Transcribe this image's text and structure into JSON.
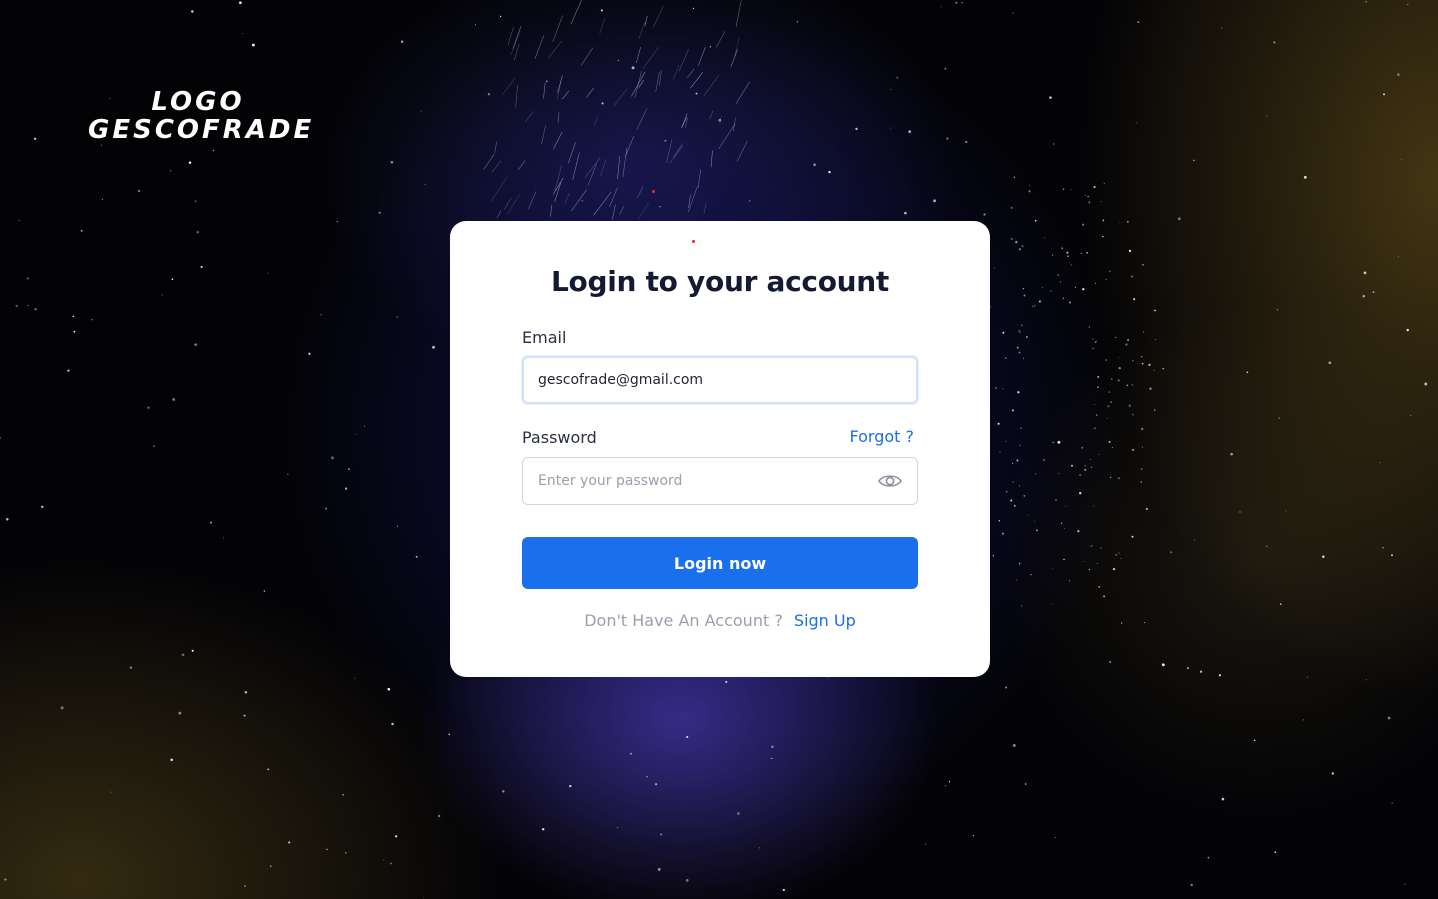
{
  "logo": {
    "line1": "LOGO",
    "line2": "GESCOFRADE"
  },
  "login_form": {
    "title": "Login to your account",
    "email_label": "Email",
    "email_value": "gescofrade@gmail.com",
    "password_label": "Password",
    "forgot_link": "Forgot ?",
    "password_placeholder": "Enter your password",
    "password_toggle_icon": "eye-icon",
    "submit_label": "Login now",
    "signup_prompt": "Don't Have An Account ?",
    "signup_link": "Sign Up"
  },
  "colors": {
    "accent": "#1a70ec",
    "link": "#1a6fe8",
    "title": "#151a33",
    "background": "#030306"
  }
}
